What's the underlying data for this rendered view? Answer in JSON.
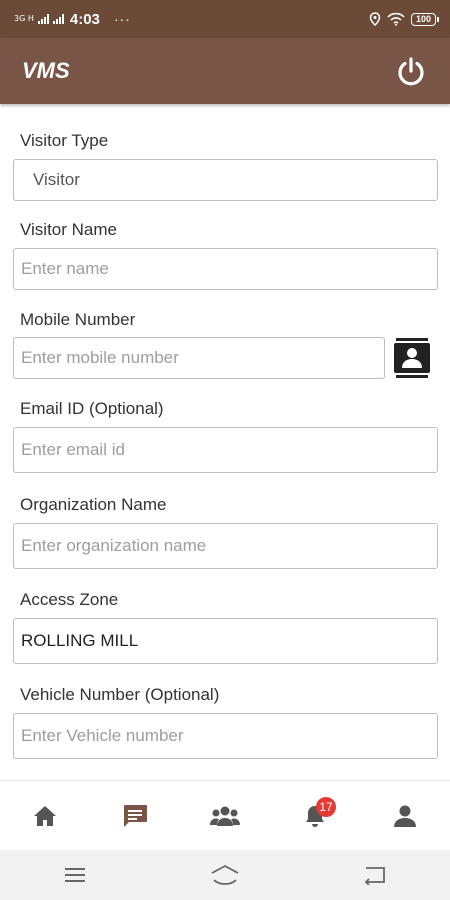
{
  "status_bar": {
    "network_label": "3G H",
    "time": "4:03",
    "more": "···",
    "battery": "100"
  },
  "app_bar": {
    "title": "VMS"
  },
  "form": {
    "visitor_type": {
      "label": "Visitor Type",
      "value": "Visitor"
    },
    "visitor_name": {
      "label": "Visitor Name",
      "placeholder": "Enter name"
    },
    "mobile_number": {
      "label": "Mobile Number",
      "placeholder": "Enter mobile number"
    },
    "email": {
      "label": "Email ID (Optional)",
      "placeholder": "Enter email id"
    },
    "organization": {
      "label": "Organization Name",
      "placeholder": "Enter organization name"
    },
    "access_zone": {
      "label": "Access Zone",
      "value": "ROLLING MILL"
    },
    "vehicle_number": {
      "label": "Vehicle Number (Optional)",
      "placeholder": "Enter Vehicle number"
    }
  },
  "bottom_nav": {
    "notification_count": "17",
    "active_item": "messages"
  },
  "colors": {
    "app_bar": "#795548",
    "status_bar": "#6b4a37",
    "active_icon": "#795548",
    "inactive_icon": "#555555",
    "badge": "#e53935"
  },
  "icons": {
    "power": "power-icon",
    "contacts": "contact-book-icon",
    "home": "home-icon",
    "messages": "message-icon",
    "visitors": "group-icon",
    "notifications": "bell-icon",
    "profile": "person-icon"
  }
}
